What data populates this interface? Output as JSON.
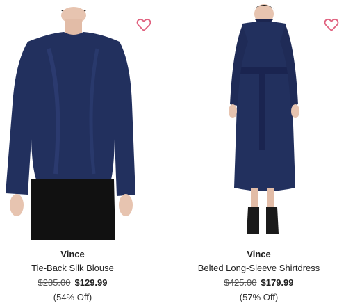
{
  "products": [
    {
      "brand": "Vince",
      "name": "Tie-Back Silk Blouse",
      "original_price": "$285.00",
      "sale_price": "$129.99",
      "discount": "(54% Off)",
      "wishlist_icon": "heart-outline-icon",
      "accent_color": "#e0607e"
    },
    {
      "brand": "Vince",
      "name": "Belted Long-Sleeve Shirtdress",
      "original_price": "$425.00",
      "sale_price": "$179.99",
      "discount": "(57% Off)",
      "wishlist_icon": "heart-outline-icon",
      "accent_color": "#e0607e"
    }
  ]
}
